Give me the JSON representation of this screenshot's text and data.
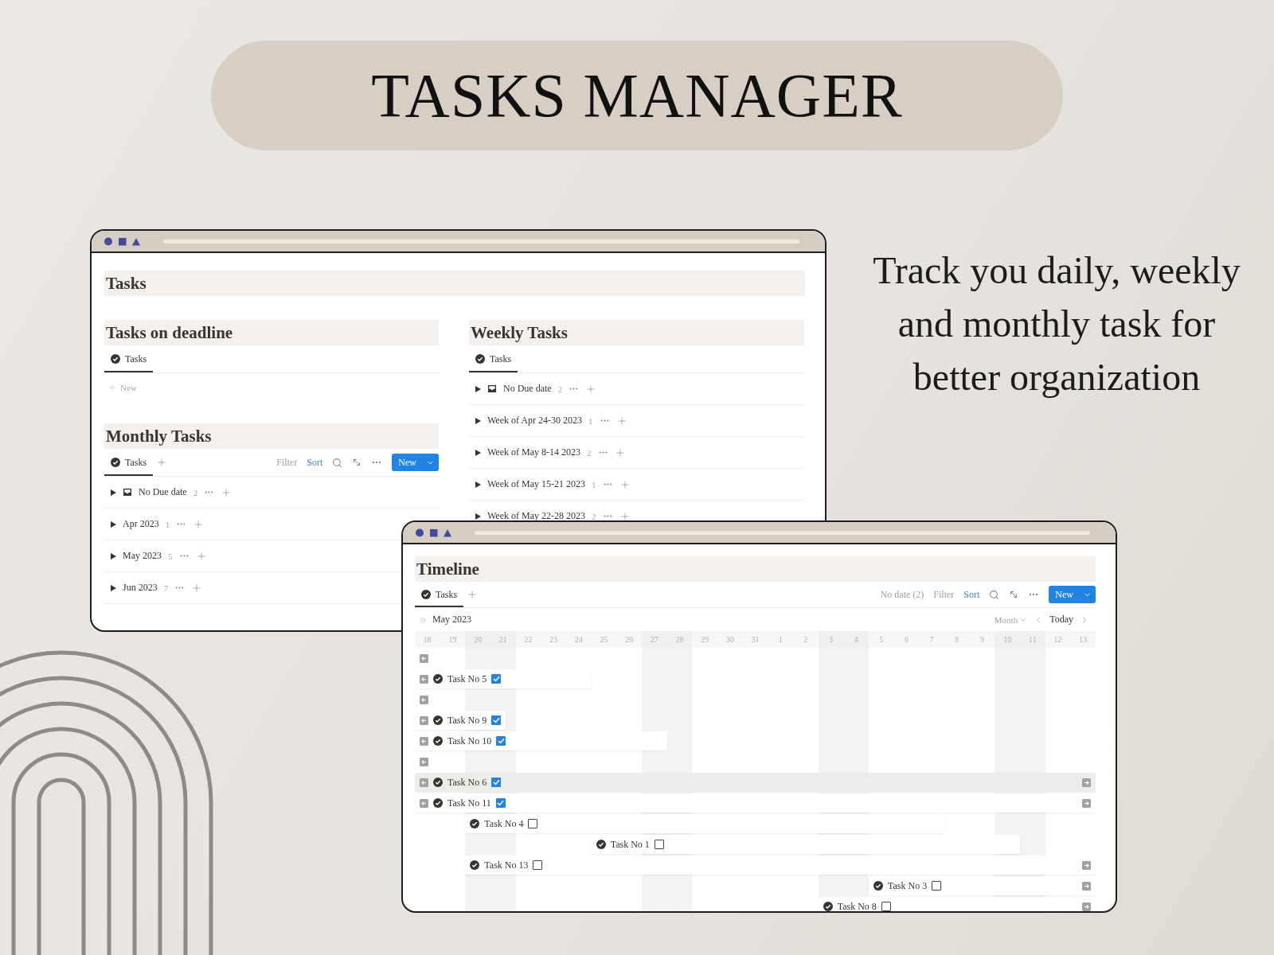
{
  "title": "TASKS MANAGER",
  "tagline": "Track you daily, weekly and monthly task for better organization",
  "tasks_window": {
    "heading": "Tasks",
    "deadline": {
      "heading": "Tasks on deadline",
      "addable": false,
      "tabs": [
        {
          "label": "Tasks",
          "selected": true
        }
      ],
      "new_label": "New"
    },
    "monthly": {
      "heading": "Monthly Tasks",
      "addable": true,
      "tabs": [
        {
          "label": "Tasks",
          "selected": true
        }
      ],
      "toolbar": {
        "filter": "Filter",
        "sort": {
          "label": "Sort",
          "active": true
        },
        "new": "New"
      },
      "groups": [
        {
          "kind": "inbox",
          "label": "No Due date",
          "count": "2"
        },
        {
          "kind": "plain",
          "label": "Apr 2023",
          "count": "1"
        },
        {
          "kind": "plain",
          "label": "May 2023",
          "count": "5"
        },
        {
          "kind": "plain",
          "label": "Jun 2023",
          "count": "7"
        }
      ]
    },
    "weekly": {
      "heading": "Weekly Tasks",
      "addable": false,
      "tabs": [
        {
          "label": "Tasks",
          "selected": true
        }
      ],
      "groups": [
        {
          "kind": "inbox",
          "label": "No Due date",
          "count": "2"
        },
        {
          "kind": "plain",
          "label": "Week of Apr 24-30 2023",
          "count": "1"
        },
        {
          "kind": "plain",
          "label": "Week of May 8-14 2023",
          "count": "2"
        },
        {
          "kind": "plain",
          "label": "Week of May 15-21 2023",
          "count": "1"
        },
        {
          "kind": "plain",
          "label": "Week of May 22-28 2023",
          "count": "2"
        }
      ]
    }
  },
  "timeline_window": {
    "heading": "Timeline",
    "addable": true,
    "tabs": [
      {
        "label": "Tasks",
        "selected": true
      }
    ],
    "toolbar": {
      "no_date": "No date (2)",
      "filter": "Filter",
      "sort": {
        "label": "Sort",
        "active": true
      },
      "new": "New"
    },
    "month": "May 2023",
    "scale": "Month",
    "today": "Today",
    "days": [
      {
        "label": "18",
        "weekend": false
      },
      {
        "label": "19",
        "weekend": false
      },
      {
        "label": "20",
        "weekend": true
      },
      {
        "label": "21",
        "weekend": true
      },
      {
        "label": "22",
        "weekend": false
      },
      {
        "label": "23",
        "weekend": false
      },
      {
        "label": "24",
        "weekend": false
      },
      {
        "label": "25",
        "weekend": false
      },
      {
        "label": "26",
        "weekend": false
      },
      {
        "label": "27",
        "weekend": true
      },
      {
        "label": "28",
        "weekend": true
      },
      {
        "label": "29",
        "weekend": false
      },
      {
        "label": "30",
        "weekend": false
      },
      {
        "label": "31",
        "weekend": false
      },
      {
        "label": "1",
        "weekend": false
      },
      {
        "label": "2",
        "weekend": false
      },
      {
        "label": "3",
        "weekend": true
      },
      {
        "label": "4",
        "weekend": true
      },
      {
        "label": "5",
        "weekend": false
      },
      {
        "label": "6",
        "weekend": false
      },
      {
        "label": "7",
        "weekend": false
      },
      {
        "label": "8",
        "weekend": false
      },
      {
        "label": "9",
        "weekend": false
      },
      {
        "label": "10",
        "weekend": true
      },
      {
        "label": "11",
        "weekend": true
      },
      {
        "label": "12",
        "weekend": false
      },
      {
        "label": "13",
        "weekend": false
      }
    ],
    "rows": [
      {
        "kind": "empty",
        "continues_left": true,
        "continues_right": false,
        "highlighted": false
      },
      {
        "kind": "task",
        "title": "Task No 5",
        "done": true,
        "continues_left": true,
        "continues_right": false,
        "highlighted": false
      },
      {
        "kind": "empty",
        "continues_left": true,
        "continues_right": false,
        "highlighted": false
      },
      {
        "kind": "task",
        "title": "Task No 9",
        "done": true,
        "continues_left": true,
        "continues_right": false,
        "highlighted": false
      },
      {
        "kind": "task",
        "title": "Task No 10",
        "done": true,
        "continues_left": true,
        "continues_right": false,
        "highlighted": false
      },
      {
        "kind": "empty",
        "continues_left": true,
        "continues_right": false,
        "highlighted": false
      },
      {
        "kind": "task",
        "title": "Task No 6",
        "done": true,
        "continues_left": true,
        "continues_right": true,
        "highlighted": true
      },
      {
        "kind": "task",
        "title": "Task No 11",
        "done": true,
        "continues_left": true,
        "continues_right": true,
        "highlighted": false
      },
      {
        "kind": "task",
        "title": "Task No 4",
        "done": false,
        "continues_left": false,
        "continues_right": false,
        "highlighted": false
      },
      {
        "kind": "task",
        "title": "Task No 1",
        "done": false,
        "continues_left": false,
        "continues_right": false,
        "highlighted": false
      },
      {
        "kind": "task",
        "title": "Task No 13",
        "done": false,
        "continues_left": false,
        "continues_right": true,
        "highlighted": false
      },
      {
        "kind": "task",
        "title": "Task No 3",
        "done": false,
        "continues_left": false,
        "continues_right": true,
        "highlighted": false
      },
      {
        "kind": "task",
        "title": "Task No 8",
        "done": false,
        "continues_left": false,
        "continues_right": true,
        "highlighted": false
      }
    ]
  }
}
